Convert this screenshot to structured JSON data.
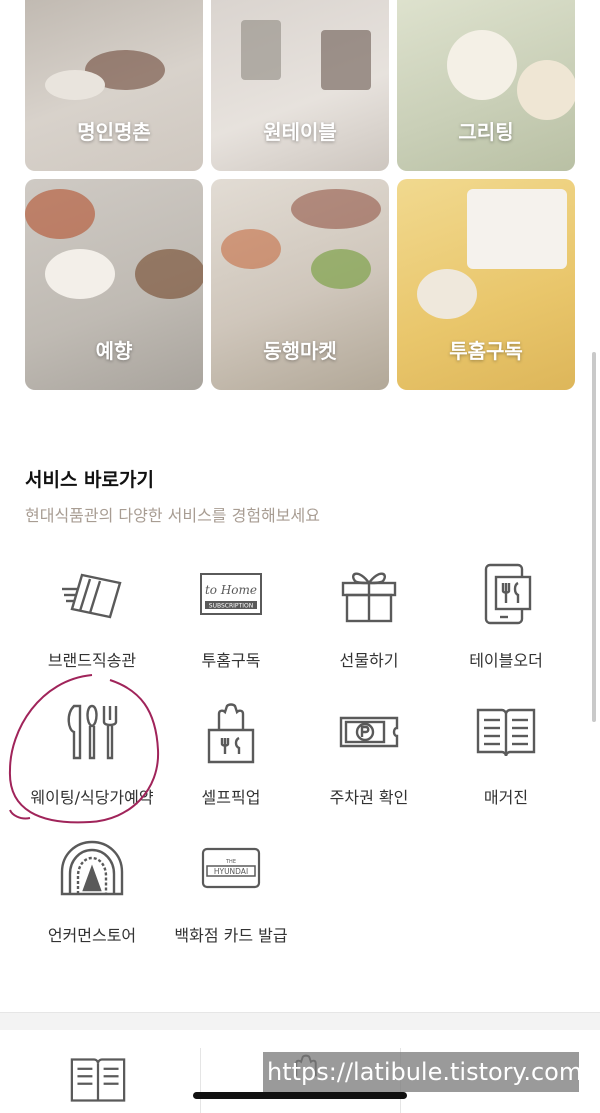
{
  "brands": [
    {
      "label": "명인명촌"
    },
    {
      "label": "원테이블"
    },
    {
      "label": "그리팅"
    },
    {
      "label": "예향"
    },
    {
      "label": "동행마켓"
    },
    {
      "label": "투홈구독"
    }
  ],
  "services_section": {
    "title": "서비스 바로가기",
    "subtitle": "현대식품관의 다양한 서비스를 경험해보세요"
  },
  "services": [
    {
      "label": "브랜드직송관",
      "icon": "box-delivery-icon"
    },
    {
      "label": "투홈구독",
      "icon": "tohome-subscription-icon"
    },
    {
      "label": "선물하기",
      "icon": "gift-icon"
    },
    {
      "label": "테이블오더",
      "icon": "mobile-order-icon"
    },
    {
      "label": "웨이팅/식당가예약",
      "icon": "cutlery-icon"
    },
    {
      "label": "셀프픽업",
      "icon": "pickup-bag-icon"
    },
    {
      "label": "주차권 확인",
      "icon": "parking-ticket-icon"
    },
    {
      "label": "매거진",
      "icon": "magazine-icon"
    },
    {
      "label": "언커먼스토어",
      "icon": "store-dome-icon"
    },
    {
      "label": "백화점 카드 발급",
      "icon": "hyundai-card-icon"
    }
  ],
  "icon_text": {
    "tohome": "to Home",
    "subscription": "SUBSCRIPTION",
    "the": "THE",
    "hyundai": "HYUNDAI"
  },
  "watermark": "https://latibule.tistory.com",
  "colors": {
    "accent_subtitle": "#a89d93",
    "annotation": "#a0245a",
    "icon_stroke": "#5a5a5a"
  }
}
